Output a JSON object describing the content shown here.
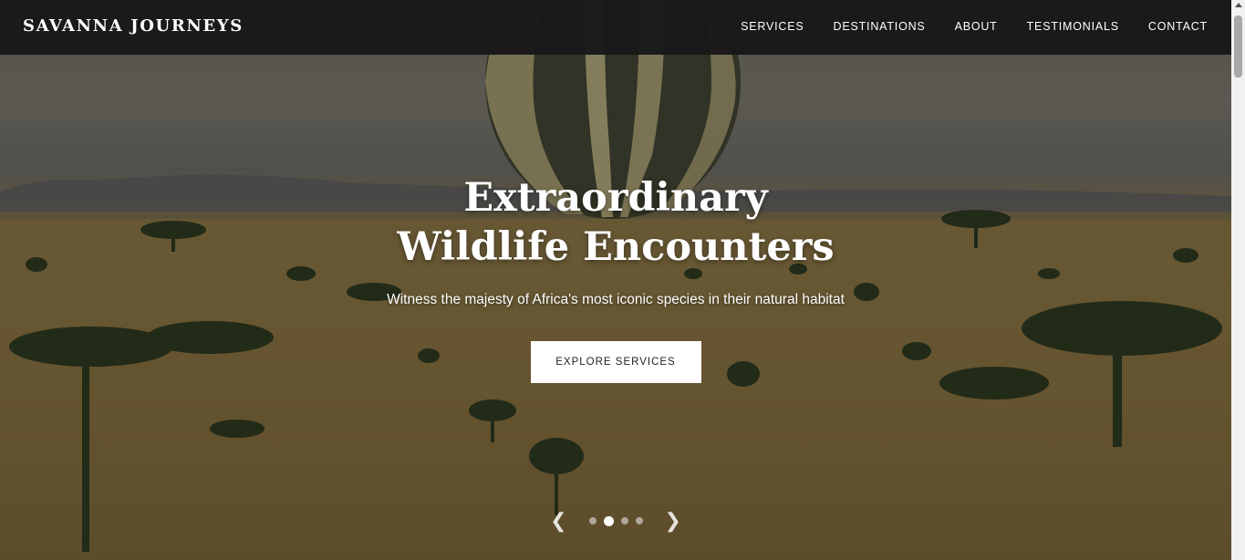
{
  "navbar": {
    "brand": "SAVANNA JOURNEYS",
    "links": [
      "SERVICES",
      "DESTINATIONS",
      "ABOUT",
      "TESTIMONIALS",
      "CONTACT"
    ]
  },
  "hero": {
    "title": "Extraordinary Wildlife Encounters",
    "subtitle": "Witness the majesty of Africa's most iconic species in their natural habitat",
    "cta_label": "EXPLORE SERVICES"
  },
  "slider": {
    "prev_symbol": "❮",
    "next_symbol": "❯",
    "slide_count": 4,
    "active_index": 1
  },
  "colors": {
    "navbar_bg": "#191919",
    "cta_bg": "#ffffff",
    "text": "#ffffff"
  }
}
